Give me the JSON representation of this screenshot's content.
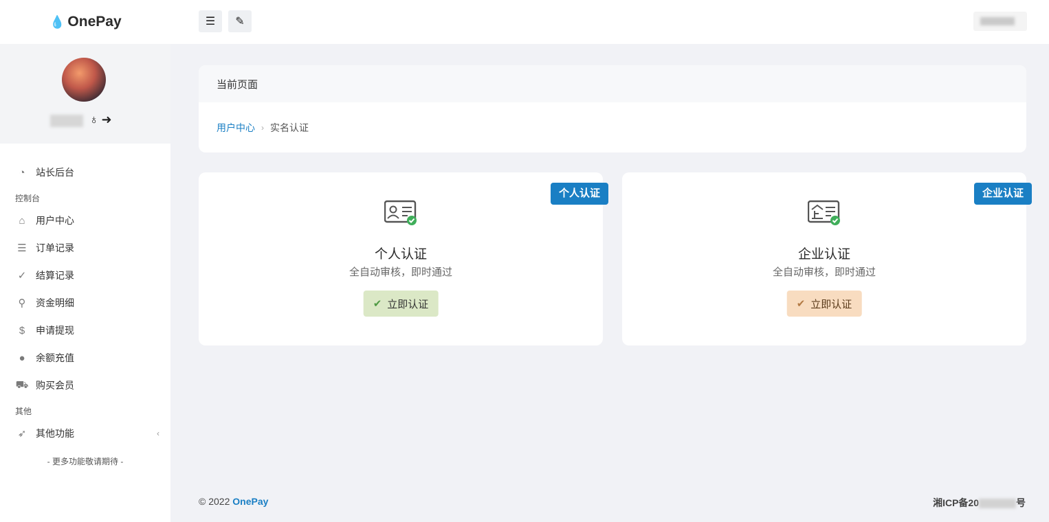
{
  "app": {
    "logo_text": "OnePay"
  },
  "sidebar": {
    "dashboard_label": "站长后台",
    "section_console": "控制台",
    "items": [
      {
        "label": "用户中心",
        "icon": "home-icon"
      },
      {
        "label": "订单记录",
        "icon": "list-icon"
      },
      {
        "label": "结算记录",
        "icon": "check-circle-icon"
      },
      {
        "label": "资金明细",
        "icon": "search-dollar-icon"
      },
      {
        "label": "申请提现",
        "icon": "dollar-icon"
      },
      {
        "label": "余额充值",
        "icon": "coin-icon"
      },
      {
        "label": "购买会员",
        "icon": "cart-icon"
      }
    ],
    "section_other": "其他",
    "other_label": "其他功能",
    "more_text": "- 更多功能敬请期待 -"
  },
  "breadcrumb": {
    "header": "当前页面",
    "link": "用户中心",
    "current": "实名认证"
  },
  "cards": {
    "personal": {
      "ribbon": "个人认证",
      "title": "个人认证",
      "subtitle": "全自动审核，即时通过",
      "button": "立即认证",
      "button_color": "#dbe8c6"
    },
    "company": {
      "ribbon": "企业认证",
      "title": "企业认证",
      "subtitle": "全自动审核，即时通过",
      "button": "立即认证",
      "button_color": "#f8dcc0"
    }
  },
  "footer": {
    "copyright": "© 2022",
    "brand": "OnePay",
    "icp_prefix": "湘ICP备20",
    "icp_suffix": "号"
  },
  "colors": {
    "accent": "#1a7fc4",
    "background": "#f1f2f6"
  }
}
